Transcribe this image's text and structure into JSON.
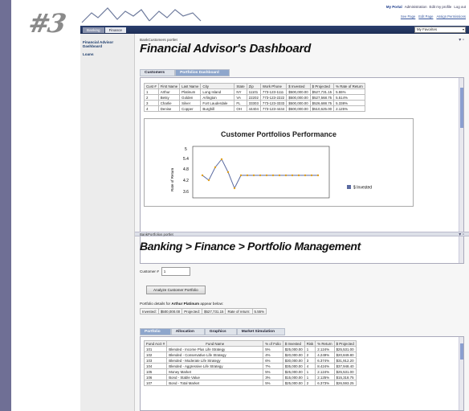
{
  "logo_text": "#3",
  "header": {
    "links": [
      "My Portal",
      "Administration",
      "Edit my profile",
      "Log out"
    ],
    "sub_links": [
      "See Page",
      "Edit Page",
      "Assign Permissions"
    ]
  },
  "nav": {
    "tabs": [
      "Banking",
      "Finance"
    ],
    "favorites": "My Favorites"
  },
  "sidebar": {
    "items": [
      "Financial Advisor Dashboard",
      "Loans"
    ]
  },
  "portlet1": {
    "label": "BankCustomers portlet",
    "title": "Financial Advisor's Dashboard",
    "tabs": [
      "Customers",
      "Portfolios Dashboard"
    ],
    "table": {
      "headers": [
        "Cust #",
        "First Name",
        "Last Name",
        "City",
        "State",
        "Zip",
        "Work Phone",
        "$ Invested",
        "$ Projected",
        "% Rate of Return"
      ],
      "rows": [
        [
          "1",
          "Arthur",
          "Platinum",
          "Long Island",
          "NY",
          "11101",
          "773-123-1111",
          "$500,000.00",
          "$527,731.15",
          "5.55%"
        ],
        [
          "2",
          "Betsy",
          "Golden",
          "Arlington",
          "VA",
          "22202",
          "773-123-2222",
          "$500,000.00",
          "$527,568.75",
          "5.514%"
        ],
        [
          "3",
          "Charlie",
          "Silver",
          "Fort Lauderdale",
          "FL",
          "33303",
          "773-123-3333",
          "$500,000.00",
          "$526,688.75",
          "5.338%"
        ],
        [
          "4",
          "Denise",
          "Copper",
          "Burghill",
          "OH",
          "44404",
          "773-123-4444",
          "$500,000.00",
          "$510,625.00",
          "2.125%"
        ]
      ]
    },
    "chart": {
      "title": "Customer Portfolios Performance",
      "y_ticks": [
        "5",
        "5.4",
        "4.8",
        "4.2",
        "3.6"
      ],
      "y_label": "Rate of Return",
      "legend": "$ Invested"
    }
  },
  "portlet2": {
    "label": "BankPortfolios portlet",
    "title": "Banking > Finance > Portfolio Management",
    "customer_label": "Customer #",
    "customer_value": "1",
    "analyze_button": "Analyze Customer Portfolio",
    "details_prefix": "Portfolio details for",
    "details_name": "Arthur Platinum",
    "details_suffix": "appear below:",
    "summary": [
      "Invested:",
      "$500,000.00",
      "Projected:",
      "$527,731.15",
      "Rate of return:",
      "5.55%"
    ],
    "tabs": [
      "Portfolio",
      "Allocation",
      "Graphics",
      "Market Simulation"
    ],
    "table": {
      "headers": [
        "Fund Acct #",
        "Fund Name",
        "% of Folio",
        "$ Invested",
        "Risk",
        "% Return",
        "$ Projected"
      ],
      "rows": [
        [
          "101",
          "Blended - Income Plus Life Strategy",
          "5%",
          "$25,000.00",
          "1",
          "2.124%",
          "$25,531.00"
        ],
        [
          "102",
          "Blended - Conservative Life Strategy",
          "4%",
          "$20,000.00",
          "2",
          "4.249%",
          "$20,849.80"
        ],
        [
          "103",
          "Blended - Moderate Life Strategy",
          "6%",
          "$30,000.00",
          "3",
          "6.374%",
          "$31,912.20"
        ],
        [
          "104",
          "Blended - Aggressive Life Strategy",
          "7%",
          "$35,000.00",
          "4",
          "8.424%",
          "$37,948.40"
        ],
        [
          "105",
          "Money Market",
          "5%",
          "$25,000.00",
          "1",
          "2.124%",
          "$25,531.00"
        ],
        [
          "106",
          "Bond - Stable Value",
          "3%",
          "$15,000.00",
          "1",
          "2.125%",
          "$15,318.75"
        ],
        [
          "107",
          "Bond - Total Market",
          "5%",
          "$25,000.00",
          "2",
          "6.373%",
          "$26,593.25"
        ]
      ]
    }
  }
}
